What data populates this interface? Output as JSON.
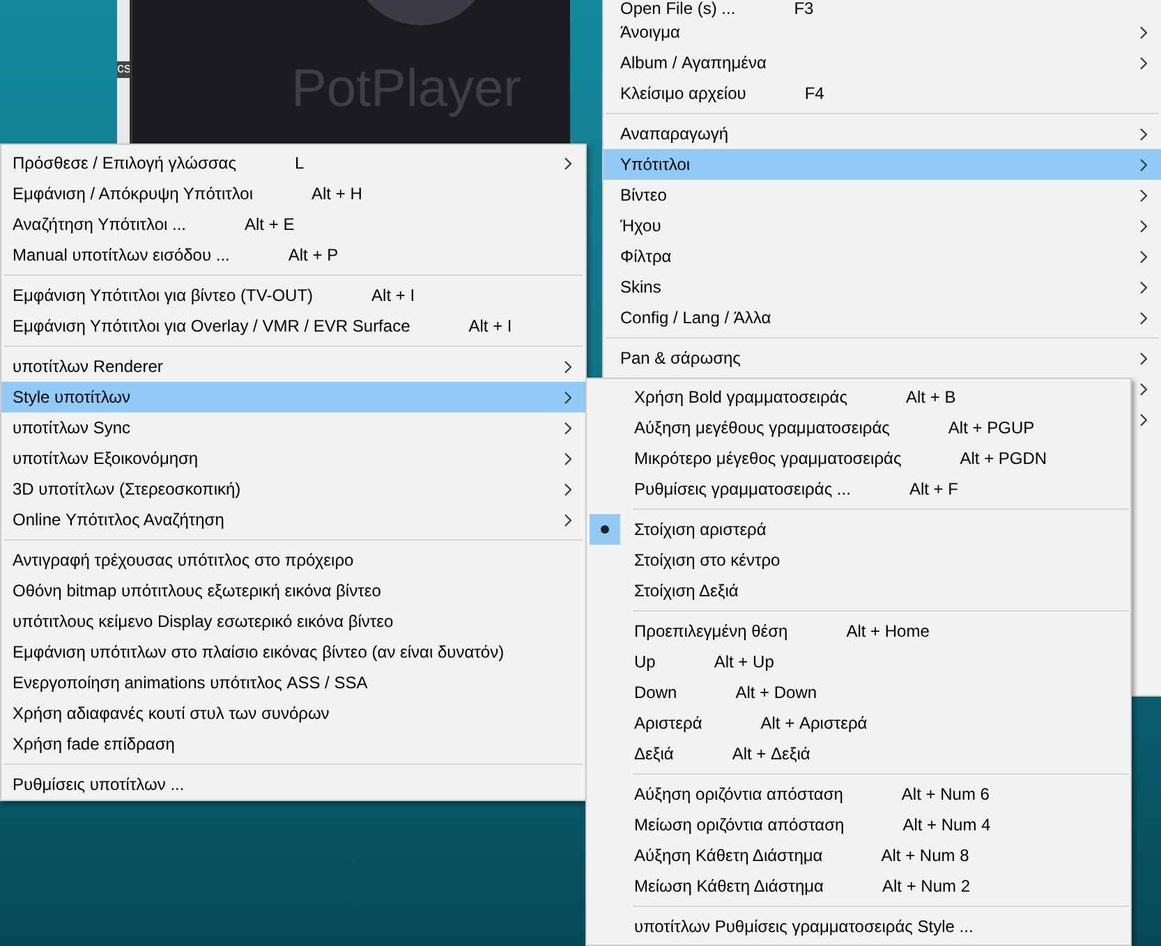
{
  "desktop": {
    "icon_label": "cs"
  },
  "player": {
    "logo": "PotPlayer"
  },
  "main_menu": {
    "items": [
      {
        "kind": "item",
        "label": "Open File (s) ...",
        "shortcut": "F3",
        "submenu": false,
        "selected": false
      },
      {
        "kind": "item",
        "label": "Άνοιγμα",
        "submenu": true,
        "selected": false
      },
      {
        "kind": "item",
        "label": "Album / Αγαπημένα",
        "submenu": true,
        "selected": false
      },
      {
        "kind": "item",
        "label": "Κλείσιμο αρχείου",
        "shortcut": "F4",
        "submenu": false,
        "selected": false
      },
      {
        "kind": "separator"
      },
      {
        "kind": "item",
        "label": "Αναπαραγωγή",
        "submenu": true,
        "selected": false
      },
      {
        "kind": "item",
        "label": "Υπότιτλοι",
        "submenu": true,
        "selected": true
      },
      {
        "kind": "item",
        "label": "Βίντεο",
        "submenu": true,
        "selected": false
      },
      {
        "kind": "item",
        "label": "Ήχου",
        "submenu": true,
        "selected": false
      },
      {
        "kind": "item",
        "label": "Φίλτρα",
        "submenu": true,
        "selected": false
      },
      {
        "kind": "item",
        "label": "Skins",
        "submenu": true,
        "selected": false
      },
      {
        "kind": "item",
        "label": "Config / Lang / Άλλα",
        "submenu": true,
        "selected": false
      },
      {
        "kind": "separator"
      },
      {
        "kind": "item",
        "label": "Pan & σάρωσης",
        "submenu": true,
        "selected": false
      }
    ]
  },
  "subtitles_menu": {
    "items": [
      {
        "kind": "item",
        "label": "Πρόσθεσε / Επιλογή γλώσσας",
        "shortcut": "L",
        "submenu": true,
        "selected": false
      },
      {
        "kind": "item",
        "label": "Εμφάνιση / Απόκρυψη Υπότιτλοι",
        "shortcut": "Alt + H",
        "submenu": false,
        "selected": false
      },
      {
        "kind": "item",
        "label": "Αναζήτηση Υπότιτλοι ...",
        "shortcut": "Alt + E",
        "submenu": false,
        "selected": false
      },
      {
        "kind": "item",
        "label": "Manual υποτίτλων εισόδου ...",
        "shortcut": "Alt + P",
        "submenu": false,
        "selected": false
      },
      {
        "kind": "separator"
      },
      {
        "kind": "item",
        "label": "Εμφάνιση Υπότιτλοι για βίντεο (TV-OUT)",
        "shortcut": "Alt + I",
        "submenu": false,
        "selected": false
      },
      {
        "kind": "item",
        "label": "Εμφάνιση Υπότιτλοι για Overlay / VMR / EVR Surface",
        "shortcut": "Alt + I",
        "submenu": false,
        "selected": false
      },
      {
        "kind": "separator"
      },
      {
        "kind": "item",
        "label": "υποτίτλων Renderer",
        "submenu": true,
        "selected": false
      },
      {
        "kind": "item",
        "label": "Style υποτίτλων",
        "submenu": true,
        "selected": true
      },
      {
        "kind": "item",
        "label": "υποτίτλων Sync",
        "submenu": true,
        "selected": false
      },
      {
        "kind": "item",
        "label": "υποτίτλων Εξοικονόμηση",
        "submenu": true,
        "selected": false
      },
      {
        "kind": "item",
        "label": "3D υποτίτλων (Στερεοσκοπική)",
        "submenu": true,
        "selected": false
      },
      {
        "kind": "item",
        "label": "Online Υπότιτλος Αναζήτηση",
        "submenu": true,
        "selected": false
      },
      {
        "kind": "separator"
      },
      {
        "kind": "item",
        "label": "Αντιγραφή τρέχουσας υπότιτλος στο πρόχειρο",
        "submenu": false,
        "selected": false
      },
      {
        "kind": "item",
        "label": "Οθόνη bitmap υπότιτλους εξωτερική εικόνα βίντεο",
        "submenu": false,
        "selected": false
      },
      {
        "kind": "item",
        "label": "υπότιτλους κείμενο Display εσωτερικό εικόνα βίντεο",
        "submenu": false,
        "selected": false
      },
      {
        "kind": "item",
        "label": "Εμφάνιση υπότιτλων στο πλαίσιο εικόνας βίντεο (αν είναι δυνατόν)",
        "submenu": false,
        "selected": false
      },
      {
        "kind": "item",
        "label": "Ενεργοποίηση animations υπότιτλος ASS / SSA",
        "submenu": false,
        "selected": false
      },
      {
        "kind": "item",
        "label": "Χρήση αδιαφανές κουτί στυλ των συνόρων",
        "submenu": false,
        "selected": false
      },
      {
        "kind": "item",
        "label": "Χρήση fade επίδραση",
        "submenu": false,
        "selected": false
      },
      {
        "kind": "separator"
      },
      {
        "kind": "item",
        "label": "Ρυθμίσεις υποτίτλων ...",
        "submenu": false,
        "selected": false
      }
    ]
  },
  "style_menu": {
    "items": [
      {
        "kind": "item",
        "label": "Χρήση Bold γραμματοσειράς",
        "shortcut": "Alt + B",
        "checked": false,
        "selected": false
      },
      {
        "kind": "item",
        "label": "Αύξηση μεγέθους γραμματοσειράς",
        "shortcut": "Alt + PGUP",
        "checked": false,
        "selected": false
      },
      {
        "kind": "item",
        "label": "Μικρότερο μέγεθος γραμματοσειράς",
        "shortcut": "Alt + PGDN",
        "checked": false,
        "selected": false
      },
      {
        "kind": "item",
        "label": "Ρυθμίσεις γραμματοσειράς ...",
        "shortcut": "Alt + F",
        "checked": false,
        "selected": false
      },
      {
        "kind": "separator"
      },
      {
        "kind": "item",
        "label": "Στοίχιση αριστερά",
        "checked": true,
        "selected": false
      },
      {
        "kind": "item",
        "label": "Στοίχιση στο κέντρο",
        "checked": false,
        "selected": false
      },
      {
        "kind": "item",
        "label": "Στοίχιση Δεξιά",
        "checked": false,
        "selected": false
      },
      {
        "kind": "separator"
      },
      {
        "kind": "item",
        "label": "Προεπιλεγμένη θέση",
        "shortcut": "Alt + Home",
        "checked": false,
        "selected": false
      },
      {
        "kind": "item",
        "label": "Up",
        "shortcut": "Alt + Up",
        "checked": false,
        "selected": false
      },
      {
        "kind": "item",
        "label": "Down",
        "shortcut": "Alt + Down",
        "checked": false,
        "selected": false
      },
      {
        "kind": "item",
        "label": "Αριστερά",
        "shortcut": "Alt + Αριστερά",
        "checked": false,
        "selected": false
      },
      {
        "kind": "item",
        "label": "Δεξιά",
        "shortcut": "Alt + Δεξιά",
        "checked": false,
        "selected": false
      },
      {
        "kind": "separator"
      },
      {
        "kind": "item",
        "label": "Αύξηση οριζόντια απόσταση",
        "shortcut": "Alt + Num 6",
        "checked": false,
        "selected": false
      },
      {
        "kind": "item",
        "label": "Μείωση οριζόντια απόσταση",
        "shortcut": "Alt + Num 4",
        "checked": false,
        "selected": false
      },
      {
        "kind": "item",
        "label": "Αύξηση Κάθετη Διάστημα",
        "shortcut": "Alt + Num 8",
        "checked": false,
        "selected": false
      },
      {
        "kind": "item",
        "label": "Μείωση Κάθετη Διάστημα",
        "shortcut": "Alt + Num 2",
        "checked": false,
        "selected": false
      },
      {
        "kind": "separator"
      },
      {
        "kind": "item",
        "label": "υποτίτλων Ρυθμίσεις γραμματοσειράς Style ...",
        "checked": false,
        "selected": false
      }
    ]
  }
}
